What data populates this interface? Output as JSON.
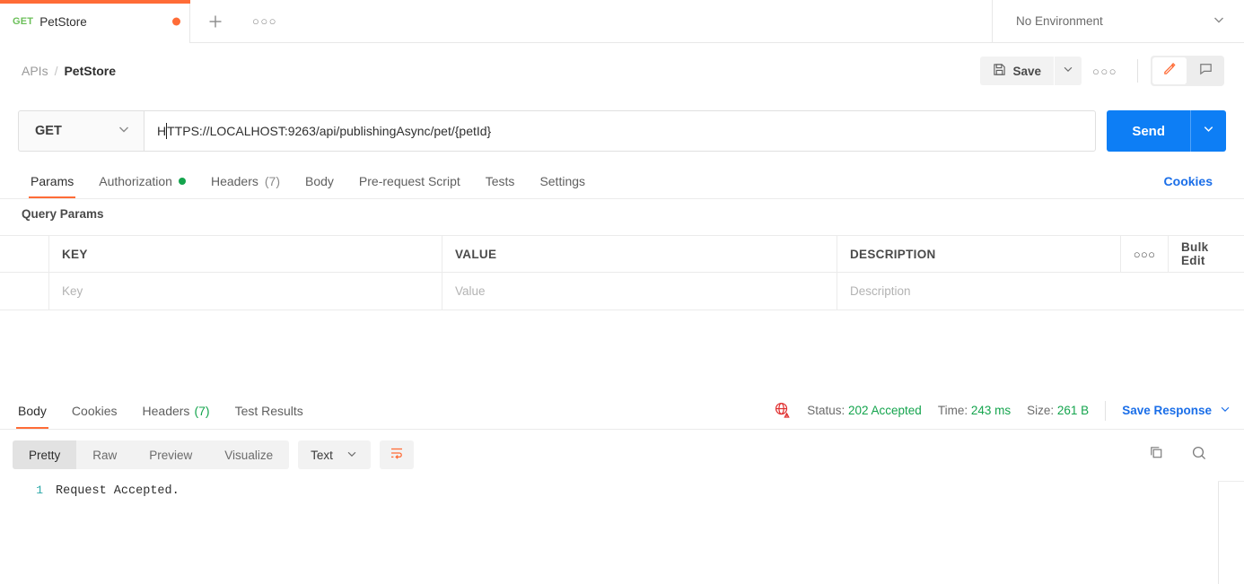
{
  "tabbar": {
    "request_tab": {
      "method": "GET",
      "name": "PetStore",
      "unsaved_indicator": "unsaved-dot"
    },
    "add_tab_icon": "plus-icon",
    "tab_options_icon": "ellipsis-icon",
    "tab_options_label": "○○○",
    "environment": {
      "label": "No Environment",
      "chevron": "chevron-down-icon"
    }
  },
  "header": {
    "breadcrumb": {
      "root": "APIs",
      "separator": "/",
      "current": "PetStore"
    },
    "save_label": "Save",
    "save_icon": "floppy-disk-icon",
    "save_caret_icon": "chevron-down-icon",
    "more_label": "○○○",
    "edit_icon": "pencil-icon",
    "comment_icon": "comment-icon"
  },
  "request": {
    "method": "GET",
    "method_chevron": "chevron-down-icon",
    "url_before_caret": "H",
    "url_after_caret": "TTPS://LOCALHOST:9263/api/publishingAsync/pet/{petId}",
    "url_full": "HTTPS://LOCALHOST:9263/api/publishingAsync/pet/{petId}",
    "send_label": "Send",
    "send_caret_icon": "chevron-down-icon",
    "send_color": "#0d7ef5"
  },
  "request_tabs": {
    "items": [
      {
        "label": "Params",
        "active": true,
        "badge": "",
        "dot": false
      },
      {
        "label": "Authorization",
        "active": false,
        "badge": "",
        "dot": true
      },
      {
        "label": "Headers",
        "active": false,
        "badge": "(7)",
        "dot": false
      },
      {
        "label": "Body",
        "active": false,
        "badge": "",
        "dot": false
      },
      {
        "label": "Pre-request Script",
        "active": false,
        "badge": "",
        "dot": false
      },
      {
        "label": "Tests",
        "active": false,
        "badge": "",
        "dot": false
      },
      {
        "label": "Settings",
        "active": false,
        "badge": "",
        "dot": false
      }
    ],
    "cookies_link": "Cookies"
  },
  "query_params": {
    "section_title": "Query Params",
    "columns": [
      "KEY",
      "VALUE",
      "DESCRIPTION"
    ],
    "row_options_label": "○○○",
    "bulk_edit_label": "Bulk Edit",
    "empty_row": {
      "key_placeholder": "Key",
      "value_placeholder": "Value",
      "description_placeholder": "Description"
    }
  },
  "response": {
    "tabs": [
      {
        "label": "Body",
        "active": true,
        "badge": ""
      },
      {
        "label": "Cookies",
        "active": false,
        "badge": ""
      },
      {
        "label": "Headers",
        "active": false,
        "badge": "(7)"
      },
      {
        "label": "Test Results",
        "active": false,
        "badge": ""
      }
    ],
    "warning_icon": "globe-warning-icon",
    "status_label": "Status:",
    "status_value": "202 Accepted",
    "time_label": "Time:",
    "time_value": "243 ms",
    "size_label": "Size:",
    "size_value": "261 B",
    "save_response_label": "Save Response",
    "save_response_caret": "chevron-down-icon",
    "status_color": "#14a44d"
  },
  "viewer_toolbar": {
    "modes": [
      {
        "label": "Pretty",
        "active": true
      },
      {
        "label": "Raw",
        "active": false
      },
      {
        "label": "Preview",
        "active": false
      },
      {
        "label": "Visualize",
        "active": false
      }
    ],
    "format": "Text",
    "format_chevron": "chevron-down-icon",
    "wrap_icon": "word-wrap-icon",
    "copy_icon": "copy-icon",
    "search_icon": "search-icon"
  },
  "response_body": {
    "lines": [
      {
        "number": "1",
        "text": "Request Accepted."
      }
    ]
  }
}
